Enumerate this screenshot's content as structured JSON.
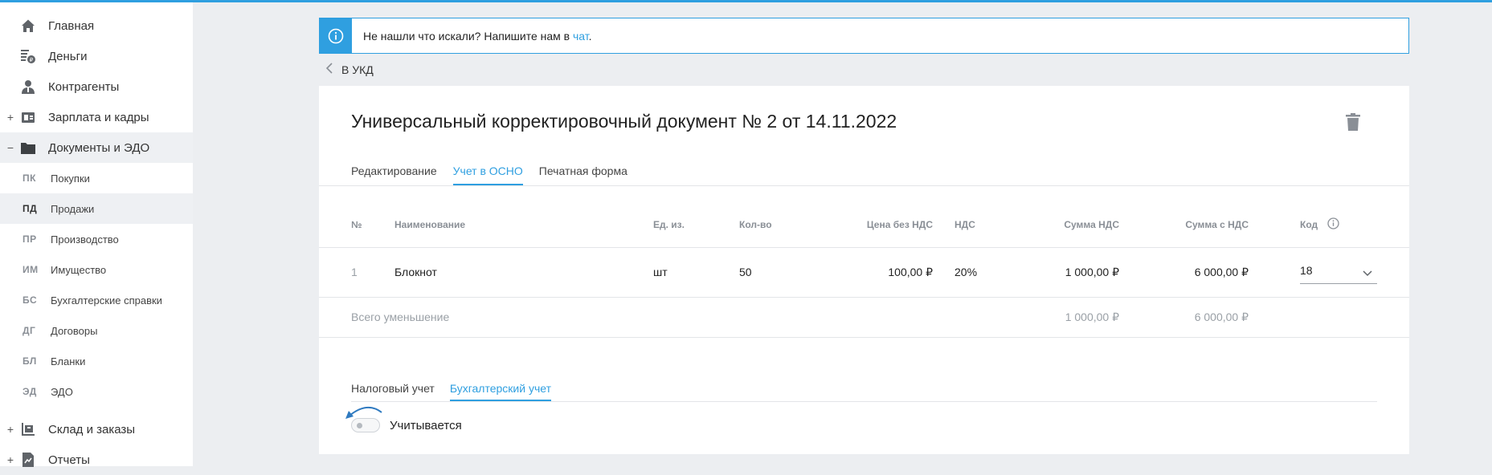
{
  "sidebar": {
    "main": [
      {
        "label": "Главная",
        "icon": "home-icon",
        "toggle": ""
      },
      {
        "label": "Деньги",
        "icon": "money-icon",
        "toggle": ""
      },
      {
        "label": "Контрагенты",
        "icon": "contractors-icon",
        "toggle": ""
      },
      {
        "label": "Зарплата и кадры",
        "icon": "salary-icon",
        "toggle": "+"
      },
      {
        "label": "Документы и ЭДО",
        "icon": "folder-icon",
        "toggle": "−"
      }
    ],
    "sub": [
      {
        "code": "ПК",
        "label": "Покупки"
      },
      {
        "code": "ПД",
        "label": "Продажи"
      },
      {
        "code": "ПР",
        "label": "Производство"
      },
      {
        "code": "ИМ",
        "label": "Имущество"
      },
      {
        "code": "БС",
        "label": "Бухгалтерские справки"
      },
      {
        "code": "ДГ",
        "label": "Договоры"
      },
      {
        "code": "БЛ",
        "label": "Бланки"
      },
      {
        "code": "ЭД",
        "label": "ЭДО"
      }
    ],
    "bottom": [
      {
        "label": "Склад и заказы",
        "icon": "warehouse-icon",
        "toggle": "+"
      },
      {
        "label": "Отчеты",
        "icon": "reports-icon",
        "toggle": "+"
      }
    ]
  },
  "banner": {
    "text": "Не нашли что искали? Напишите нам в ",
    "link": "чат",
    "suffix": "."
  },
  "back": {
    "label": "В УКД"
  },
  "document": {
    "title": "Универсальный корректировочный документ № 2 от 14.11.2022"
  },
  "tabs": [
    "Редактирование",
    "Учет в ОСНО",
    "Печатная форма"
  ],
  "table": {
    "headers": {
      "num": "№",
      "name": "Наименование",
      "unit": "Ед. из.",
      "qty": "Кол-во",
      "price": "Цена без НДС",
      "vat": "НДС",
      "vat_sum": "Сумма НДС",
      "total": "Сумма с НДС",
      "code": "Код"
    },
    "row": {
      "num": "1",
      "name": "Блокнот",
      "unit": "шт",
      "qty": "50",
      "price": "100,00 ₽",
      "vat": "20%",
      "vat_sum": "1 000,00 ₽",
      "total": "6 000,00 ₽",
      "code": "18"
    },
    "summary": {
      "label": "Всего уменьшение",
      "vat_sum": "1 000,00 ₽",
      "total": "6 000,00 ₽"
    }
  },
  "subtabs": [
    "Налоговый учет",
    "Бухгалтерский учет"
  ],
  "toggle": {
    "label": "Учитывается",
    "on": false
  },
  "colors": {
    "accent": "#2f9fe0",
    "background": "#eceef1",
    "muted": "#8a8f96"
  }
}
